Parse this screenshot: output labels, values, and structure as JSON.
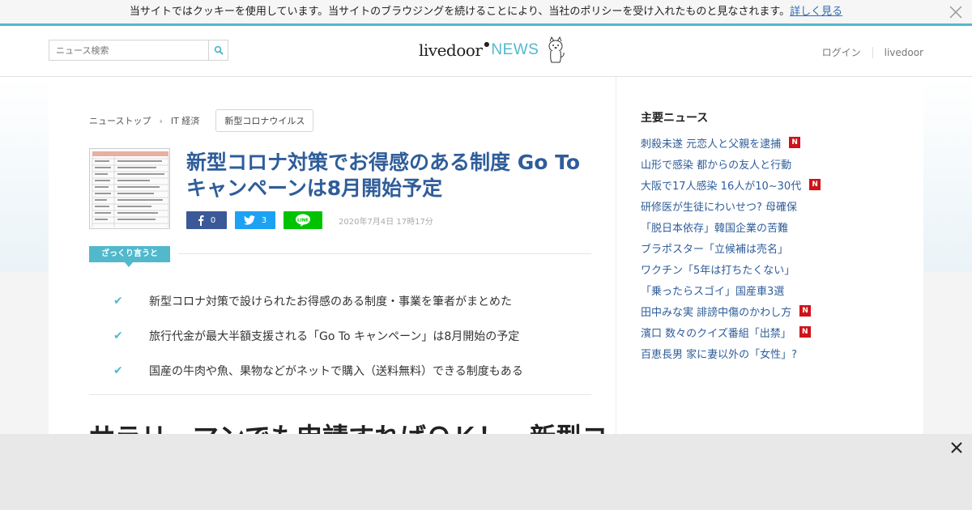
{
  "cookie": {
    "message": "当サイトではクッキーを使用しています。当サイトのブラウジングを続けることにより、当社のポリシーを受け入れたものと見なされます。",
    "link": "詳しく見る",
    "close_icon": "close-icon"
  },
  "header": {
    "search_placeholder": "ニュース検索",
    "search_icon": "search-icon",
    "logo_main": "livedoor",
    "logo_news": "NEWS",
    "login": "ログイン",
    "livedoor_link": "livedoor"
  },
  "breadcrumb": {
    "home": "ニューストップ",
    "category": "IT 経済",
    "tag": "新型コロナウイルス"
  },
  "article": {
    "title": "新型コロナ対策でお得感のある制度 Go To キャンペーンは8月開始予定",
    "fb_count": "0",
    "tw_count": "3",
    "date": "2020年7月4日 17時17分",
    "summary_label": "ざっくり言うと",
    "summary": [
      "新型コロナ対策で設けられたお得感のある制度・事業を筆者がまとめた",
      "旅行代金が最大半額支援される「Go To キャンペーン」は8月開始の予定",
      "国産の牛肉や魚、果物などがネットで購入（送料無料）できる制度もある"
    ],
    "heading": "サラリーマンでも申請すればＯＫ！　新型コ"
  },
  "sidebar": {
    "title": "主要ニュース",
    "items": [
      {
        "label": "刺殺未遂 元恋人と父親を逮捕",
        "badge": "N"
      },
      {
        "label": "山形で感染 都からの友人と行動",
        "badge": ""
      },
      {
        "label": "大阪で17人感染 16人が10~30代",
        "badge": "N"
      },
      {
        "label": "研修医が生徒にわいせつ? 母確保",
        "badge": ""
      },
      {
        "label": "「脱日本依存」韓国企業の苦難",
        "badge": ""
      },
      {
        "label": "ブラポスター「立候補は売名」",
        "badge": ""
      },
      {
        "label": "ワクチン「5年は打ちたくない」",
        "badge": ""
      },
      {
        "label": "「乗ったらスゴイ」国産車3選",
        "badge": ""
      },
      {
        "label": "田中みな実 誹謗中傷のかわし方",
        "badge": "N"
      },
      {
        "label": "濱口 数々のクイズ番組「出禁」",
        "badge": "N"
      },
      {
        "label": "百恵長男 家に妻以外の「女性」?",
        "badge": ""
      }
    ]
  },
  "colors": {
    "accent": "#52b8cc",
    "link": "#2f5d9a",
    "facebook": "#3b5998",
    "twitter": "#1da1f2",
    "line": "#00c300",
    "badge": "#d0121b"
  }
}
